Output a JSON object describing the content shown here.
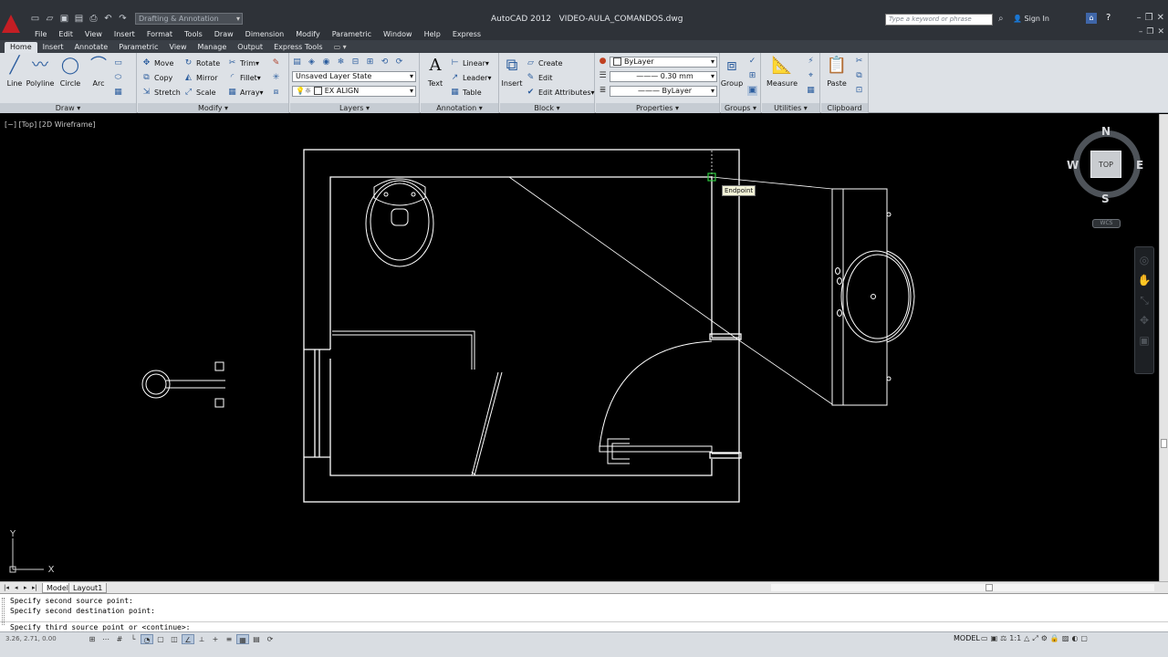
{
  "titlebar": {
    "app_title": "AutoCAD 2012",
    "file_name": "VIDEO-AULA_COMANDOS.dwg",
    "workspace": "Drafting & Annotation",
    "search_placeholder": "Type a keyword or phrase",
    "sign_in": "Sign In",
    "qat_icons": [
      "new-icon",
      "open-icon",
      "save-icon",
      "saveas-icon",
      "print-icon",
      "undo-icon",
      "redo-icon"
    ]
  },
  "menubar": {
    "items": [
      "File",
      "Edit",
      "View",
      "Insert",
      "Format",
      "Tools",
      "Draw",
      "Dimension",
      "Modify",
      "Parametric",
      "Window",
      "Help",
      "Express"
    ]
  },
  "ribbon_tabs": {
    "items": [
      "Home",
      "Insert",
      "Annotate",
      "Parametric",
      "View",
      "Manage",
      "Output",
      "Express Tools"
    ],
    "active": "Home"
  },
  "ribbon": {
    "draw": {
      "title": "Draw",
      "tools": [
        "Line",
        "Polyline",
        "Circle",
        "Arc"
      ]
    },
    "modify": {
      "title": "Modify",
      "rows": [
        [
          "Move",
          "Rotate",
          "Trim"
        ],
        [
          "Copy",
          "Mirror",
          "Fillet"
        ],
        [
          "Stretch",
          "Scale",
          "Array"
        ]
      ]
    },
    "layers": {
      "title": "Layers",
      "layer_state": "Unsaved Layer State",
      "current_layer": "EX ALIGN"
    },
    "annotation": {
      "title": "Annotation",
      "text_label": "Text",
      "items": [
        "Linear",
        "Leader",
        "Table"
      ]
    },
    "block": {
      "title": "Block",
      "insert_label": "Insert",
      "items": [
        "Create",
        "Edit",
        "Edit Attributes"
      ]
    },
    "properties": {
      "title": "Properties",
      "color": "ByLayer",
      "lineweight": "0.30 mm",
      "linetype": "ByLayer"
    },
    "groups": {
      "title": "Groups",
      "group_label": "Group"
    },
    "utilities": {
      "title": "Utilities",
      "measure_label": "Measure"
    },
    "clipboard": {
      "title": "Clipboard",
      "paste_label": "Paste"
    }
  },
  "drawing": {
    "viewport_label": "[−] [Top] [2D Wireframe]",
    "osnap_tooltip": "Endpoint",
    "ucs_x": "X",
    "ucs_y": "Y",
    "line_color": "#ffffff"
  },
  "viewcube": {
    "top": "TOP",
    "north": "N",
    "south": "S",
    "east": "E",
    "west": "W",
    "wcs": "WCS"
  },
  "layout_tabs": {
    "items": [
      "Model",
      "Layout1"
    ],
    "active": "Model"
  },
  "command_line": {
    "history": [
      "Specify second source point:",
      "Specify second destination point:"
    ],
    "prompt": "Specify third source point or <continue>:"
  },
  "statusbar": {
    "coordinates": "3.26, 2.71, 0.00",
    "model": "MODEL",
    "annotation_scale": "1:1"
  }
}
